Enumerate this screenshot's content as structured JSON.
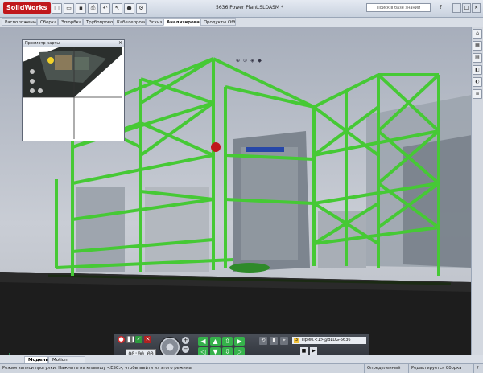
{
  "app": {
    "logo_text": "SolidWorks",
    "document_title": "5636 Power Plant.SLDASM *",
    "search_placeholder": "Поиск в базе знаний",
    "toolbar_icons": [
      "new-icon",
      "open-icon",
      "save-icon",
      "print-icon",
      "undo-icon",
      "select-icon",
      "rebuild-icon",
      "options-icon"
    ],
    "window_controls": [
      "_",
      "□",
      "×"
    ]
  },
  "command_tabs": [
    {
      "label": "Расположение",
      "active": false
    },
    {
      "label": "Сборка",
      "active": false
    },
    {
      "label": "Эпюрбка",
      "active": false
    },
    {
      "label": "Трубопровод",
      "active": false
    },
    {
      "label": "Кабелепровод",
      "active": false
    },
    {
      "label": "Эскиз",
      "active": false
    },
    {
      "label": "Анализировать",
      "active": true
    },
    {
      "label": "Продукты Office",
      "active": false
    }
  ],
  "minimap": {
    "title": "Просмотр карты",
    "close_label": "×"
  },
  "walkthrough_toolbar": {
    "timer": "00:00.00",
    "sequence_number": "3",
    "sequence_label": "Прим.<1>@BLDG-5636",
    "zoom_in": "+",
    "zoom_out": "−"
  },
  "bottom_tabs": [
    {
      "label": "Модель",
      "active": true
    },
    {
      "label": "Motion Study 1",
      "active": false
    }
  ],
  "status": {
    "message": "Режим записи прогулки. Нажмите на клавишу <ESC>, чтобы выйти из этого режима.",
    "state": "Определенный",
    "edit_mode": "Редактируется Сборка",
    "help": "?"
  },
  "colors": {
    "structure_green": "#4cd63a",
    "structure_dark": "#1c2a16",
    "accent_red": "#c0171c",
    "control_green": "#35b24a"
  }
}
